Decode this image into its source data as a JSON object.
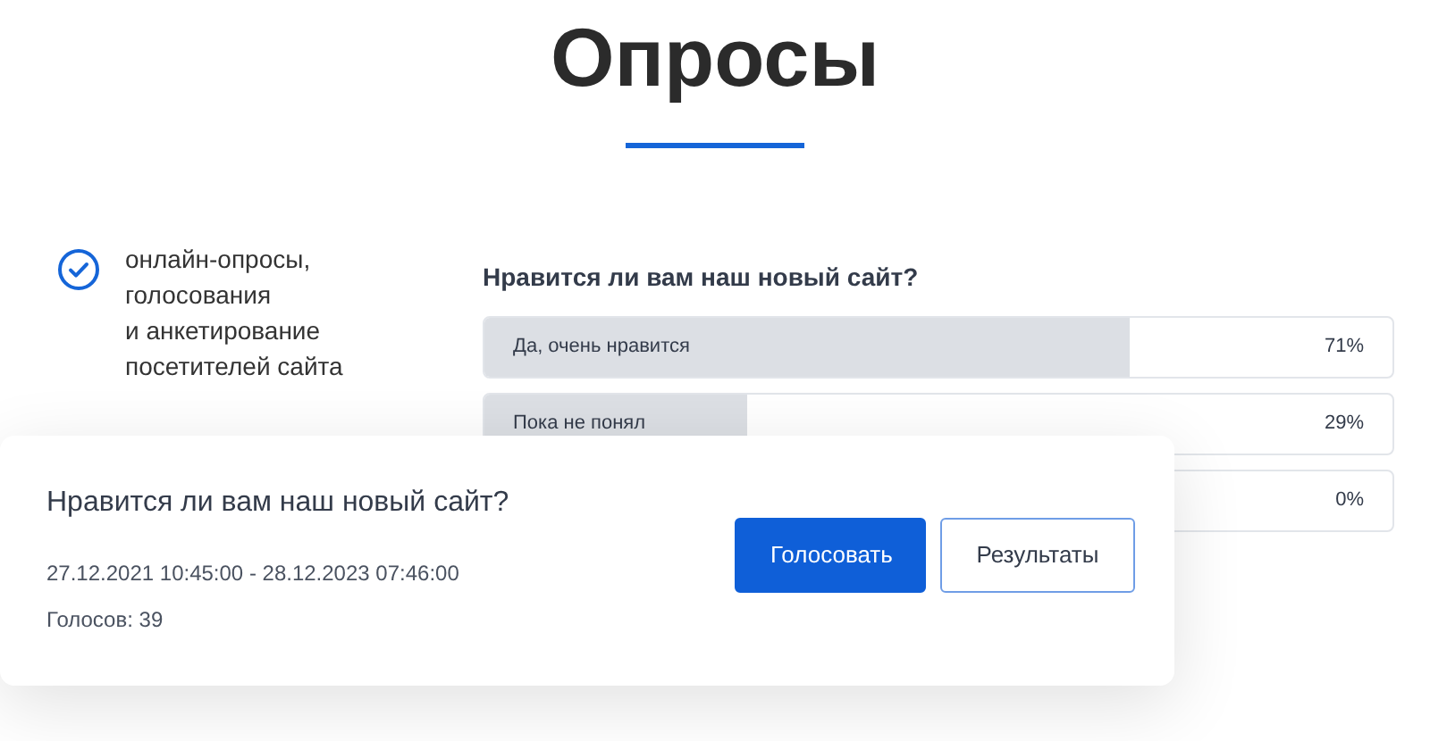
{
  "heading": "Опросы",
  "feature": {
    "text": "онлайн-опросы,\nголосования\nи анкетирование\nпосетителей сайта"
  },
  "results": {
    "question": "Нравится ли вам наш новый сайт?",
    "options": [
      {
        "label": "Да, очень нравится",
        "percent": "71%",
        "level": 0.71
      },
      {
        "label": "Пока не понял",
        "percent": "29%",
        "level": 0.29
      },
      {
        "percent": "0%",
        "level": 0
      }
    ]
  },
  "poll_card": {
    "question": "Нравится ли вам наш новый сайт?",
    "period": "27.12.2021 10:45:00 - 28.12.2023 07:46:00",
    "votes": "Голосов: 39",
    "buttons": [
      {
        "label": "Голосовать",
        "kind": "primary"
      },
      {
        "label": "Результаты",
        "kind": "outline"
      }
    ]
  }
}
